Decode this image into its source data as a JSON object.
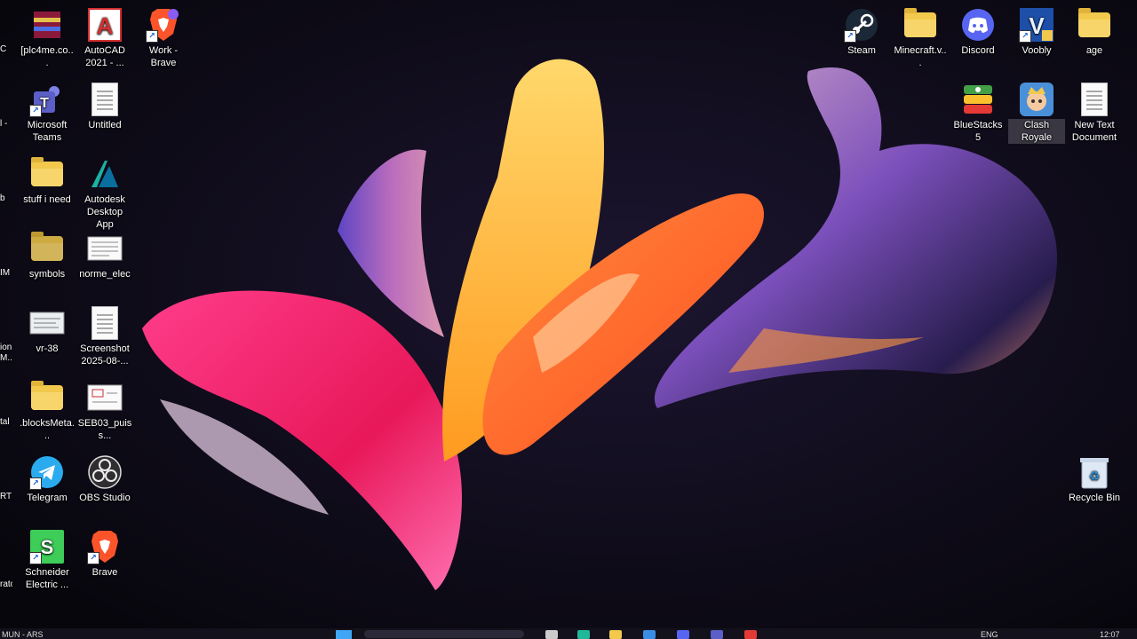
{
  "desktop": {
    "left_column_1": [
      {
        "name": "winrar",
        "label": "[plc4me.co...",
        "icon": "winrar-icon",
        "color": "#8b1a3a"
      },
      {
        "name": "microsoft-teams",
        "label": "Microsoft Teams",
        "icon": "teams-icon",
        "color": "#5b5fc7"
      },
      {
        "name": "stuff-i-need",
        "label": "stuff i need",
        "icon": "folder-icon",
        "color": "#f2c94c"
      },
      {
        "name": "symbols",
        "label": "symbols",
        "icon": "folder-icon",
        "color": "#f2c94c"
      },
      {
        "name": "vr-38",
        "label": "vr-38",
        "icon": "image-file-icon",
        "color": "#cfd8dc"
      },
      {
        "name": "blocksmeta",
        "label": ".blocksMeta...",
        "icon": "folder-icon",
        "color": "#f2c94c"
      },
      {
        "name": "telegram",
        "label": "Telegram",
        "icon": "telegram-icon",
        "color": "#2aabee"
      },
      {
        "name": "schneider-electric",
        "label": "Schneider Electric ...",
        "icon": "schneider-icon",
        "color": "#3dcd58"
      }
    ],
    "left_column_2": [
      {
        "name": "autocad",
        "label": "AutoCAD 2021 - ...",
        "icon": "autocad-icon",
        "color": "#d32f2f"
      },
      {
        "name": "untitled",
        "label": "Untitled",
        "icon": "document-icon",
        "color": "#ffffff"
      },
      {
        "name": "autodesk-desktop-app",
        "label": "Autodesk Desktop App",
        "icon": "autodesk-icon",
        "color": "#1bb1a5"
      },
      {
        "name": "norme-elec",
        "label": "norme_elec",
        "icon": "document-icon",
        "color": "#ffffff"
      },
      {
        "name": "screenshot",
        "label": "Screenshot 2025-08-...",
        "icon": "document-icon",
        "color": "#ffffff"
      },
      {
        "name": "seb03-puiss",
        "label": "SEB03_puiss...",
        "icon": "document-icon",
        "color": "#ffffff"
      },
      {
        "name": "obs-studio",
        "label": "OBS Studio",
        "icon": "obs-icon",
        "color": "#302e31"
      },
      {
        "name": "brave",
        "label": "Brave",
        "icon": "brave-icon",
        "color": "#fb542b"
      }
    ],
    "left_column_3": [
      {
        "name": "work-brave",
        "label": "Work - Brave",
        "icon": "brave-icon",
        "color": "#fb542b"
      }
    ],
    "right_row_1": [
      {
        "name": "steam",
        "label": "Steam",
        "icon": "steam-icon",
        "color": "#1b2838"
      },
      {
        "name": "minecraft",
        "label": "Minecraft.v...",
        "icon": "folder-icon",
        "color": "#f2c94c"
      },
      {
        "name": "discord",
        "label": "Discord",
        "icon": "discord-icon",
        "color": "#5865f2"
      },
      {
        "name": "voobly",
        "label": "Voobly",
        "icon": "voobly-icon",
        "color": "#1e4fa8"
      },
      {
        "name": "age",
        "label": "age",
        "icon": "folder-icon",
        "color": "#f2c94c"
      }
    ],
    "right_row_2": [
      {
        "name": "bluestacks",
        "label": "BlueStacks 5",
        "icon": "bluestacks-icon",
        "color": "#43a047"
      },
      {
        "name": "clash-royale",
        "label": "Clash Royale",
        "icon": "clash-royale-icon",
        "color": "#4a90d9"
      },
      {
        "name": "new-text-document",
        "label": "New Text Document",
        "icon": "document-icon",
        "color": "#ffffff"
      }
    ],
    "recycle_bin": {
      "label": "Recycle Bin",
      "icon": "recycle-bin-icon"
    },
    "partial_labels": [
      "C",
      "l -",
      "b",
      "IM",
      "ion M...",
      "tal",
      "RT",
      "rator"
    ]
  },
  "taskbar": {
    "left_text": "MUN - ARS",
    "language": "ENG",
    "time": "12:07"
  },
  "colors": {
    "background": "#0a0812",
    "taskbar": "#14121c"
  }
}
